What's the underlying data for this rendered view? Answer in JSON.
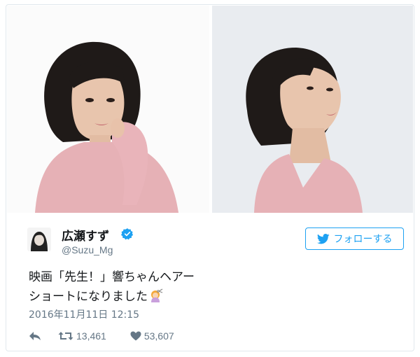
{
  "tweet": {
    "author_name": "広瀬すず",
    "handle": "@Suzu_Mg",
    "follow_label": "フォローする",
    "text_line1": "映画「先生！」響ちゃんヘアー",
    "text_line2": "ショートになりました",
    "timestamp": "2016年11月11日 12:15",
    "retweet_count": "13,461",
    "like_count": "53,607"
  },
  "icons": {
    "verified": "verified-badge-icon",
    "bird": "twitter-bird-icon",
    "reply": "reply-icon",
    "retweet": "retweet-icon",
    "like": "heart-icon",
    "haircut": "haircut-emoji-icon"
  },
  "colors": {
    "accent": "#1da1f2",
    "text": "#14171a",
    "muted": "#657786",
    "border": "#e1e8ed"
  }
}
